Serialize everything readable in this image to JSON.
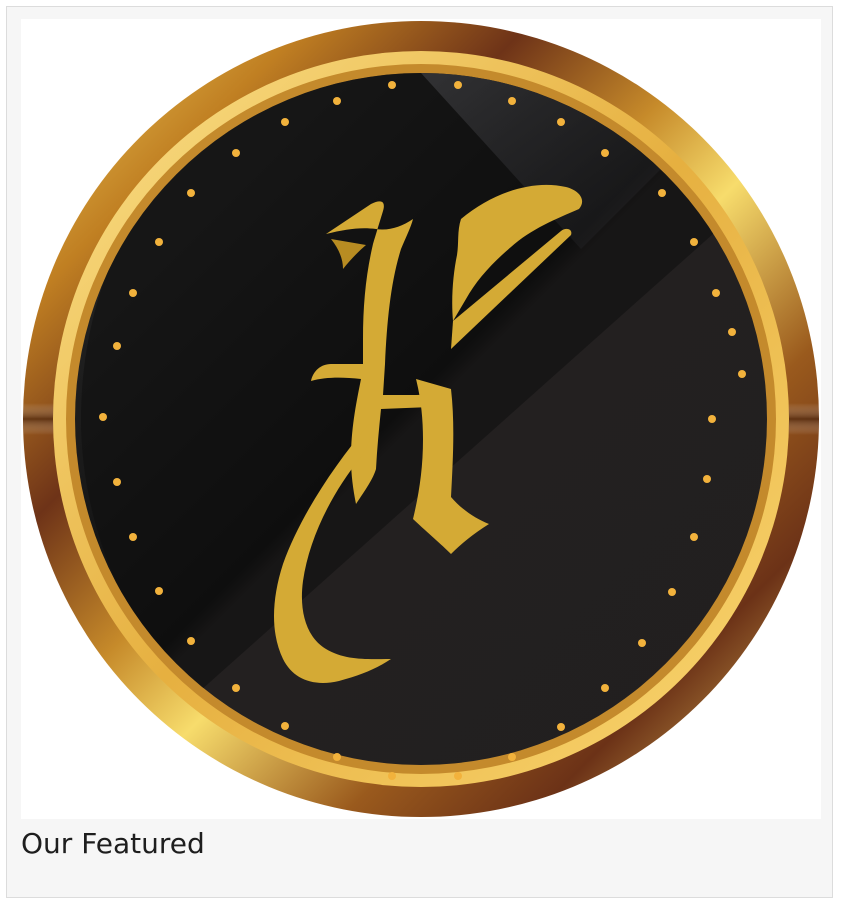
{
  "featured": {
    "caption": "Our Featured",
    "logo": {
      "icon": "gothic-x-coin-logo",
      "colors": {
        "gold": "#d4aa35",
        "face": "#211e1e",
        "dots": "#f2b23c",
        "ring_dark": "#6e3318",
        "ring_light": "#f8de6a"
      }
    }
  }
}
